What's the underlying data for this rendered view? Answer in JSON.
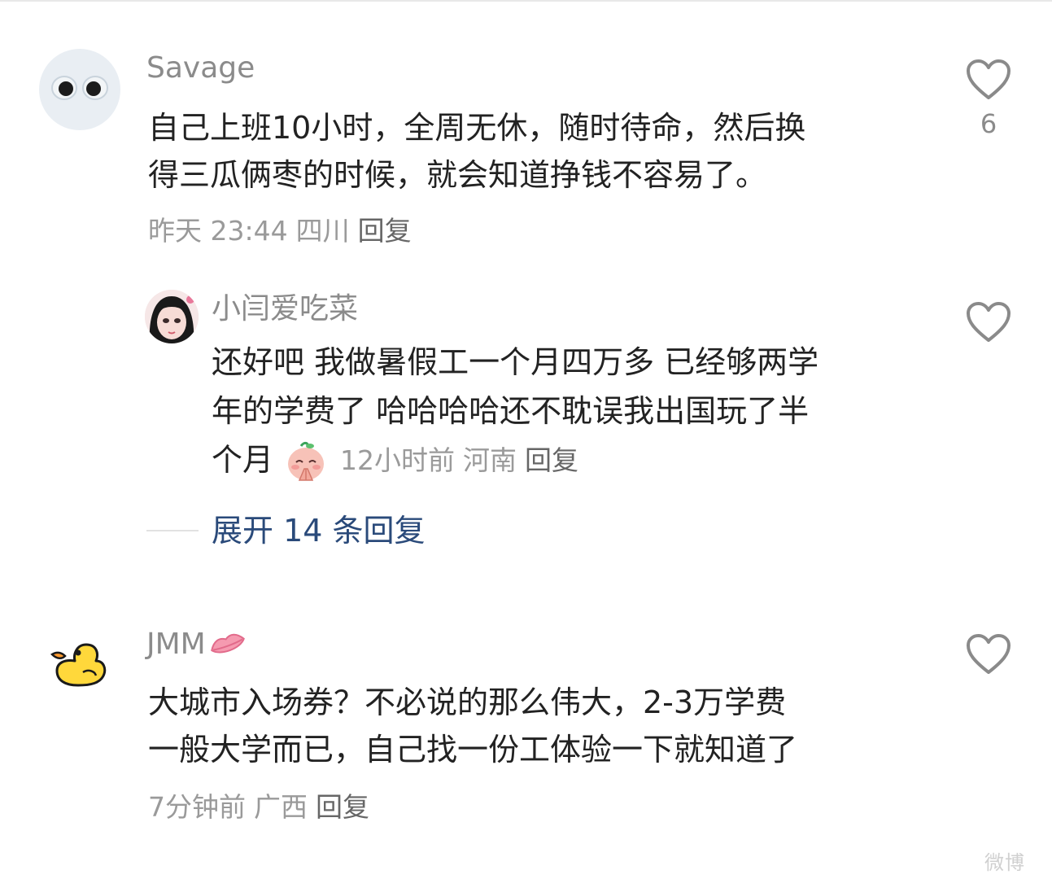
{
  "comments": [
    {
      "username": "Savage",
      "avatar_icon": "eyes-avatar-icon",
      "text_line1": "自己上班10小时，全周无休，随时待命，然后换",
      "text_line2": "得三瓜俩枣的时候，就会知道挣钱不容易了。",
      "time": "昨天 23:44",
      "location": "四川",
      "reply_label": "回复",
      "like_count": "6",
      "like_icon": "heart-outline-icon"
    },
    {
      "username": "小闫爱吃菜",
      "avatar_icon": "anime-girl-avatar-icon",
      "text_line1": "还好吧 我做暑假工一个月四万多 已经够两学",
      "text_line2": "年的学费了 哈哈哈哈还不耽误我出国玩了半",
      "text_line3": "个月",
      "emoji_icon": "praying-face-emoji-icon",
      "time": "12小时前",
      "location": "河南",
      "reply_label": "回复",
      "like_icon": "heart-outline-icon"
    },
    {
      "username": "JMM",
      "username_emoji": "lips-emoji-icon",
      "avatar_icon": "yellow-duck-avatar-icon",
      "text_line1": "大城市入场券？不必说的那么伟大，2-3万学费",
      "text_line2": "一般大学而已，自己找一份工体验一下就知道了",
      "time": "7分钟前",
      "location": "广西",
      "reply_label": "回复",
      "like_icon": "heart-outline-icon"
    }
  ],
  "expand_replies": {
    "label": "展开 14 条回复"
  },
  "watermark": {
    "label": "微博"
  },
  "colors": {
    "link_blue": "#2a4a7a",
    "text_dark": "#222222",
    "text_gray": "#8b8b8b"
  }
}
